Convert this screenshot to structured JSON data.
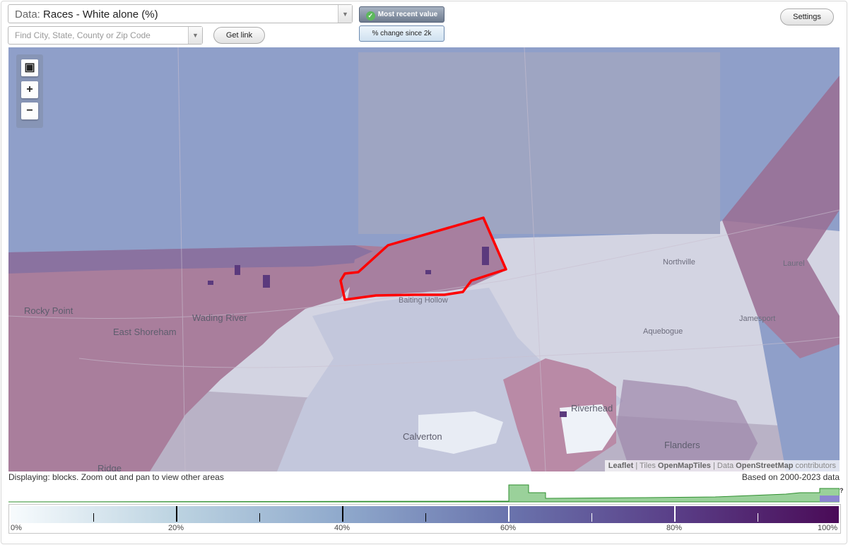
{
  "controls": {
    "data_prefix": "Data:",
    "data_value": "Races - White alone (%)",
    "location_placeholder": "Find City, State, County or Zip Code",
    "get_link": "Get link",
    "settings": "Settings",
    "most_recent": "Most recent value",
    "pct_change": "% change since 2k"
  },
  "map": {
    "zoom_full_icon": "fullscreen-icon",
    "zoom_in": "+",
    "zoom_out": "−",
    "places": {
      "rocky_point": "Rocky Point",
      "east_shoreham": "East Shoreham",
      "wading_river": "Wading River",
      "baiting_hollow": "Baiting Hollow",
      "northville": "Northville",
      "laurel": "Laurel",
      "aquebogue": "Aquebogue",
      "jamesport": "Jamesport",
      "riverhead": "Riverhead",
      "calverton": "Calverton",
      "flanders": "Flanders",
      "ridge": "Ridge"
    },
    "attribution": {
      "leaflet": "Leaflet",
      "sep1": " | Tiles ",
      "tiles": "OpenMapTiles",
      "sep2": " | Data ",
      "data": "OpenStreetMap",
      "contrib": " contributors"
    }
  },
  "status": {
    "displaying": "Displaying: blocks. Zoom out and pan to view other areas",
    "based_on": "Based on 2000-2023 data",
    "unknown_mark": "?"
  },
  "legend": {
    "labels": [
      "0%",
      "20%",
      "40%",
      "60%",
      "80%",
      "100%"
    ],
    "colors": {
      "low": "#f7fbfd",
      "mid": "#8fa9cc",
      "high": "#4a0b57",
      "highlight": "#ff0000",
      "water": "#8f9fc9"
    }
  }
}
